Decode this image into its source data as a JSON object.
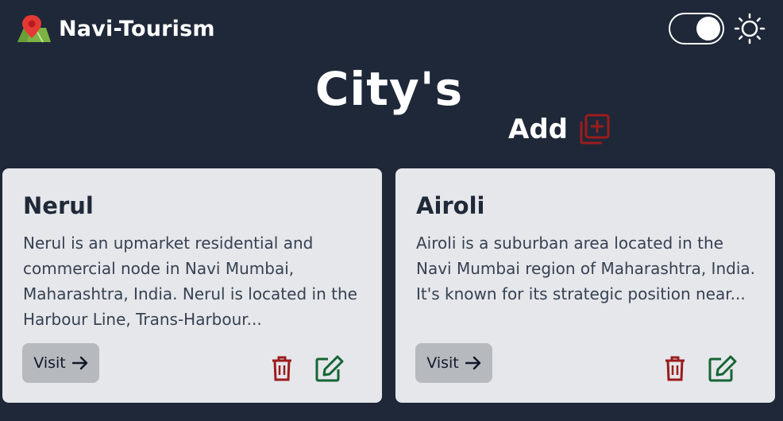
{
  "header": {
    "brand_title": "Navi-Tourism",
    "brand_icon": "map-pin-icon",
    "theme_toggle_on": true
  },
  "page": {
    "title": "City's",
    "add_label": "Add"
  },
  "cards": [
    {
      "title": "Nerul",
      "description": "Nerul is an upmarket residential and commercial node in Navi Mumbai, Maharashtra, India. Nerul is located in the Harbour Line, Trans-Harbour...",
      "visit_label": "Visit"
    },
    {
      "title": "Airoli",
      "description": "Airoli is a suburban area located in the Navi Mumbai region of Maharashtra, India. It's known for its strategic position near...",
      "visit_label": "Visit"
    }
  ],
  "colors": {
    "background": "#1f2839",
    "card": "#e5e7eb",
    "delete": "#9b1c1c",
    "edit": "#166534",
    "visit_button": "#b6babf"
  }
}
